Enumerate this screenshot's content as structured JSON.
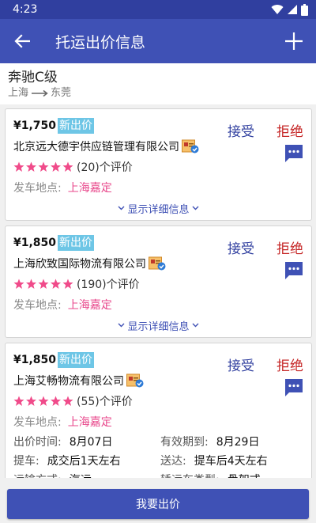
{
  "status_bar": {
    "time": "4:23"
  },
  "app_bar": {
    "title": "托运出价信息"
  },
  "summary": {
    "car": "奔驰C级",
    "from": "上海",
    "to": "东莞"
  },
  "bids": [
    {
      "price": "¥1,750",
      "badge": "新出价",
      "company": "北京远大德宇供应链管理有限公司",
      "rating_count": "(20)个评价",
      "stars": 5,
      "depart_label": "发车地点:",
      "depart_value": "上海嘉定",
      "details_toggle": "显示详细信息",
      "accept": "接受",
      "reject": "拒绝"
    },
    {
      "price": "¥1,850",
      "badge": "新出价",
      "company": "上海欣致国际物流有限公司",
      "rating_count": "(190)个评价",
      "stars": 5,
      "depart_label": "发车地点:",
      "depart_value": "上海嘉定",
      "details_toggle": "显示详细信息",
      "accept": "接受",
      "reject": "拒绝"
    },
    {
      "price": "¥1,850",
      "badge": "新出价",
      "company": "上海艾畅物流有限公司",
      "rating_count": "(55)个评价",
      "stars": 5,
      "depart_label": "发车地点:",
      "depart_value": "上海嘉定",
      "accept": "接受",
      "reject": "拒绝",
      "details": {
        "bid_time_label": "出价时间:",
        "bid_time": "8月07日",
        "valid_until_label": "有效期到:",
        "valid_until": "8月29日",
        "pickup_label": "提车:",
        "pickup": "成交后1天左右",
        "delivery_label": "送达:",
        "delivery": "提车后4天左右",
        "transport_label": "运输方式:",
        "transport": "汽运",
        "truck_type_label": "轿运车类型:",
        "truck_type": "骨架式"
      }
    }
  ],
  "bottom": {
    "bid_button": "我要出价"
  },
  "colors": {
    "primary": "#3f51b5",
    "status_bar": "#303f9f",
    "badge": "#6ec6e6",
    "star": "#f04b8a",
    "reject": "#c62828",
    "depart": "#e8478b"
  }
}
